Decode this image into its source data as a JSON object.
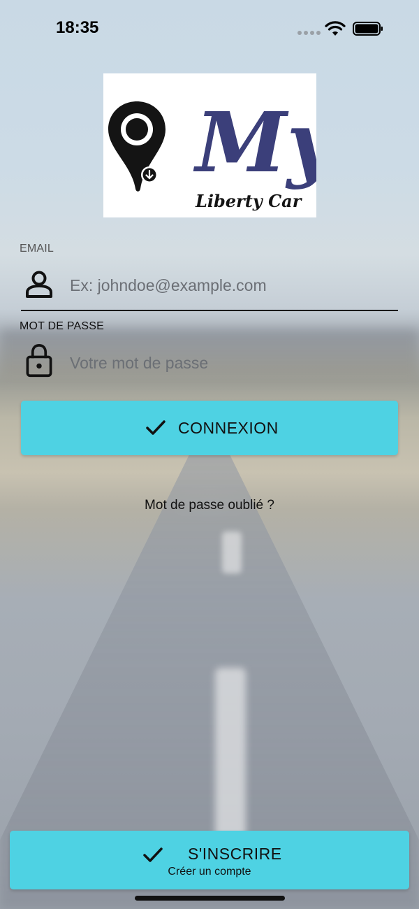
{
  "status_bar": {
    "time": "18:35"
  },
  "logo": {
    "text_main": "My",
    "text_sub": "Liberty Car"
  },
  "login_form": {
    "email_label": "EMAIL",
    "email_placeholder": "Ex: johndoe@example.com",
    "email_value": "",
    "password_label": "MOT DE PASSE",
    "password_placeholder": "Votre mot de passe",
    "password_value": "",
    "login_button_label": "CONNEXION",
    "forgot_password": "Mot de passe oublié ?"
  },
  "signup": {
    "button_label": "S'INSCRIRE",
    "button_sublabel": "Créer un compte"
  },
  "colors": {
    "accent": "#4ed2e3",
    "logo_text": "#3b3f7a"
  },
  "icons": [
    "wifi-icon",
    "battery-icon",
    "map-pin-icon",
    "user-icon",
    "lock-icon",
    "check-icon"
  ]
}
